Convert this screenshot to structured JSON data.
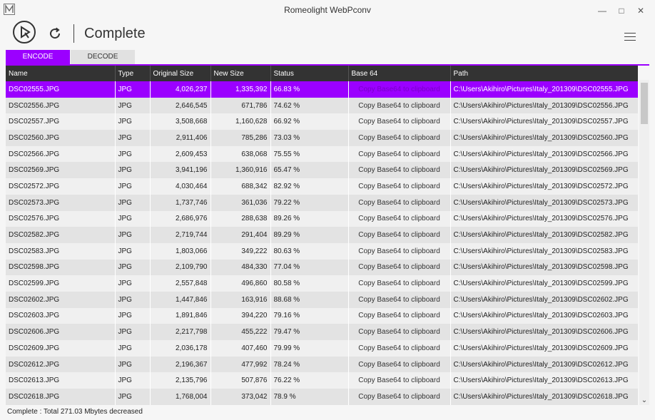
{
  "window": {
    "title": "Romeolight WebPconv"
  },
  "toolbar": {
    "status_title": "Complete"
  },
  "tabs": [
    {
      "label": "ENCODE"
    },
    {
      "label": "DECODE"
    }
  ],
  "table": {
    "headers": [
      "Name",
      "Type",
      "Original Size",
      "New Size",
      "Status",
      "Base 64",
      "Path"
    ],
    "rows": [
      [
        "DSC02555.JPG",
        "JPG",
        "4,026,237",
        "1,335,392",
        "66.83 %",
        "Copy Base64 to clipboard",
        "C:\\Users\\Akihiro\\Pictures\\Italy_201309\\DSC02555.JPG"
      ],
      [
        "DSC02556.JPG",
        "JPG",
        "2,646,545",
        "671,786",
        "74.62 %",
        "Copy Base64 to clipboard",
        "C:\\Users\\Akihiro\\Pictures\\Italy_201309\\DSC02556.JPG"
      ],
      [
        "DSC02557.JPG",
        "JPG",
        "3,508,668",
        "1,160,628",
        "66.92 %",
        "Copy Base64 to clipboard",
        "C:\\Users\\Akihiro\\Pictures\\Italy_201309\\DSC02557.JPG"
      ],
      [
        "DSC02560.JPG",
        "JPG",
        "2,911,406",
        "785,286",
        "73.03 %",
        "Copy Base64 to clipboard",
        "C:\\Users\\Akihiro\\Pictures\\Italy_201309\\DSC02560.JPG"
      ],
      [
        "DSC02566.JPG",
        "JPG",
        "2,609,453",
        "638,068",
        "75.55 %",
        "Copy Base64 to clipboard",
        "C:\\Users\\Akihiro\\Pictures\\Italy_201309\\DSC02566.JPG"
      ],
      [
        "DSC02569.JPG",
        "JPG",
        "3,941,196",
        "1,360,916",
        "65.47 %",
        "Copy Base64 to clipboard",
        "C:\\Users\\Akihiro\\Pictures\\Italy_201309\\DSC02569.JPG"
      ],
      [
        "DSC02572.JPG",
        "JPG",
        "4,030,464",
        "688,342",
        "82.92 %",
        "Copy Base64 to clipboard",
        "C:\\Users\\Akihiro\\Pictures\\Italy_201309\\DSC02572.JPG"
      ],
      [
        "DSC02573.JPG",
        "JPG",
        "1,737,746",
        "361,036",
        "79.22 %",
        "Copy Base64 to clipboard",
        "C:\\Users\\Akihiro\\Pictures\\Italy_201309\\DSC02573.JPG"
      ],
      [
        "DSC02576.JPG",
        "JPG",
        "2,686,976",
        "288,638",
        "89.26 %",
        "Copy Base64 to clipboard",
        "C:\\Users\\Akihiro\\Pictures\\Italy_201309\\DSC02576.JPG"
      ],
      [
        "DSC02582.JPG",
        "JPG",
        "2,719,744",
        "291,404",
        "89.29 %",
        "Copy Base64 to clipboard",
        "C:\\Users\\Akihiro\\Pictures\\Italy_201309\\DSC02582.JPG"
      ],
      [
        "DSC02583.JPG",
        "JPG",
        "1,803,066",
        "349,222",
        "80.63 %",
        "Copy Base64 to clipboard",
        "C:\\Users\\Akihiro\\Pictures\\Italy_201309\\DSC02583.JPG"
      ],
      [
        "DSC02598.JPG",
        "JPG",
        "2,109,790",
        "484,330",
        "77.04 %",
        "Copy Base64 to clipboard",
        "C:\\Users\\Akihiro\\Pictures\\Italy_201309\\DSC02598.JPG"
      ],
      [
        "DSC02599.JPG",
        "JPG",
        "2,557,848",
        "496,860",
        "80.58 %",
        "Copy Base64 to clipboard",
        "C:\\Users\\Akihiro\\Pictures\\Italy_201309\\DSC02599.JPG"
      ],
      [
        "DSC02602.JPG",
        "JPG",
        "1,447,846",
        "163,916",
        "88.68 %",
        "Copy Base64 to clipboard",
        "C:\\Users\\Akihiro\\Pictures\\Italy_201309\\DSC02602.JPG"
      ],
      [
        "DSC02603.JPG",
        "JPG",
        "1,891,846",
        "394,220",
        "79.16 %",
        "Copy Base64 to clipboard",
        "C:\\Users\\Akihiro\\Pictures\\Italy_201309\\DSC02603.JPG"
      ],
      [
        "DSC02606.JPG",
        "JPG",
        "2,217,798",
        "455,222",
        "79.47 %",
        "Copy Base64 to clipboard",
        "C:\\Users\\Akihiro\\Pictures\\Italy_201309\\DSC02606.JPG"
      ],
      [
        "DSC02609.JPG",
        "JPG",
        "2,036,178",
        "407,460",
        "79.99 %",
        "Copy Base64 to clipboard",
        "C:\\Users\\Akihiro\\Pictures\\Italy_201309\\DSC02609.JPG"
      ],
      [
        "DSC02612.JPG",
        "JPG",
        "2,196,367",
        "477,992",
        "78.24 %",
        "Copy Base64 to clipboard",
        "C:\\Users\\Akihiro\\Pictures\\Italy_201309\\DSC02612.JPG"
      ],
      [
        "DSC02613.JPG",
        "JPG",
        "2,135,796",
        "507,876",
        "76.22 %",
        "Copy Base64 to clipboard",
        "C:\\Users\\Akihiro\\Pictures\\Italy_201309\\DSC02613.JPG"
      ],
      [
        "DSC02618.JPG",
        "JPG",
        "1,768,004",
        "373,042",
        "78.9 %",
        "Copy Base64 to clipboard",
        "C:\\Users\\Akihiro\\Pictures\\Italy_201309\\DSC02618.JPG"
      ]
    ],
    "selected_row": 0
  },
  "statusbar": {
    "text": "Complete : Total 271.03 Mbytes decreased"
  },
  "colors": {
    "accent": "#9b00ff",
    "header_bg": "#333333"
  }
}
